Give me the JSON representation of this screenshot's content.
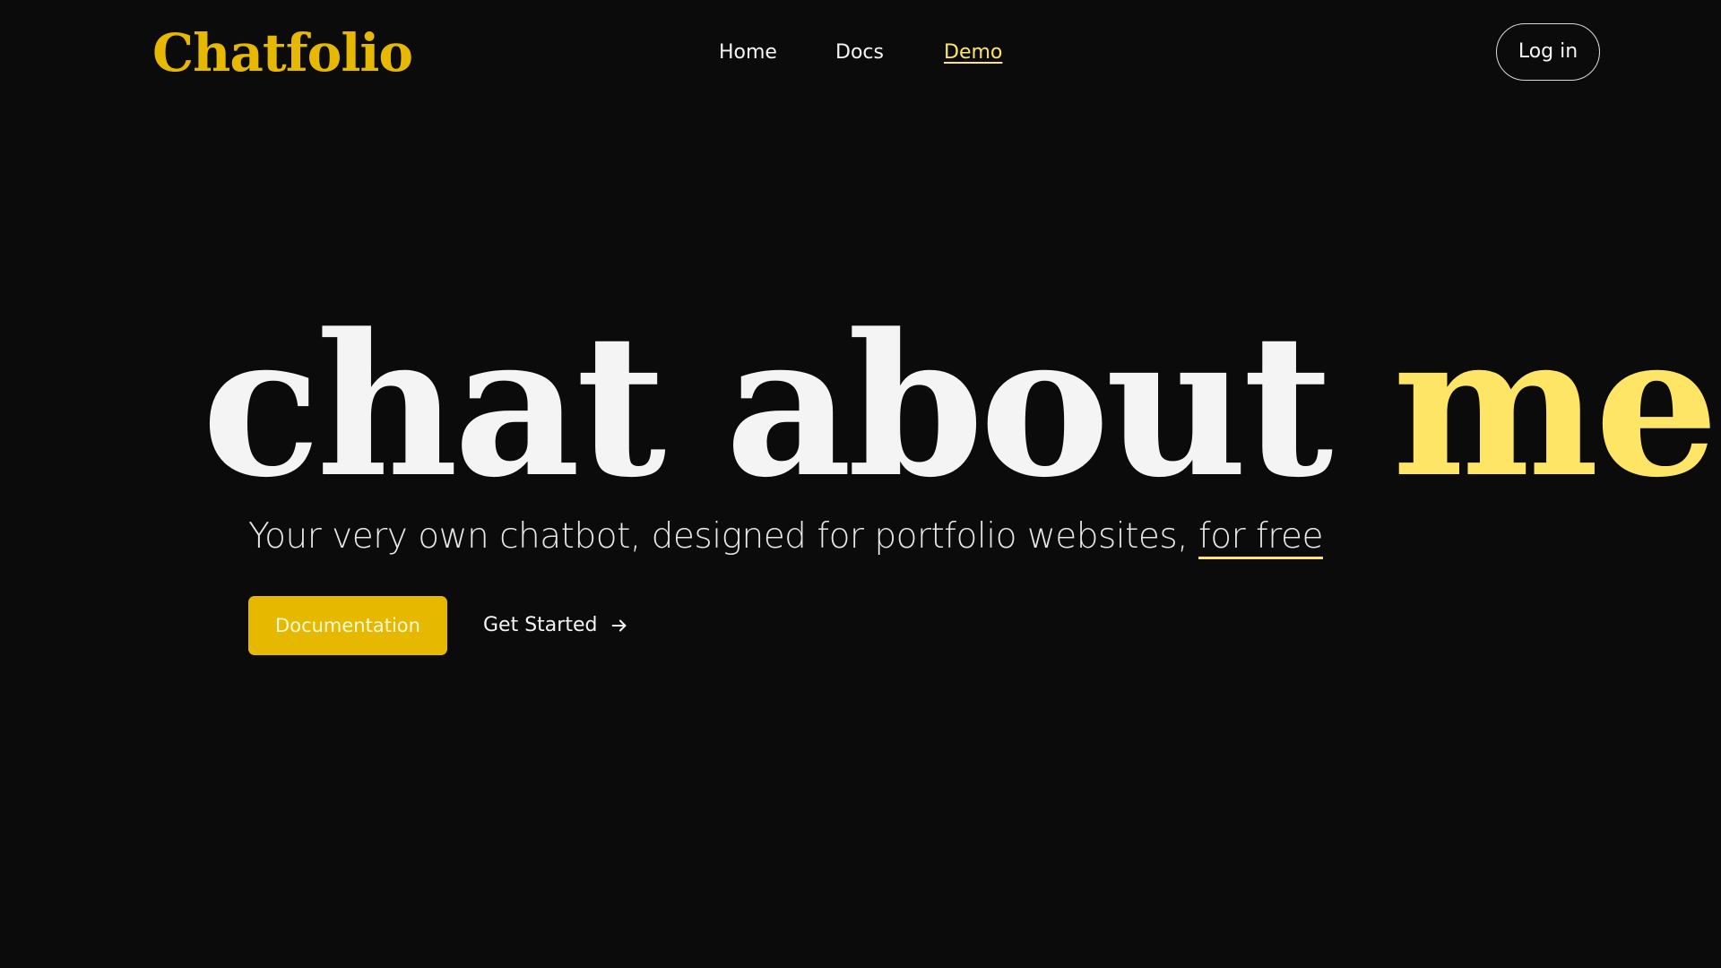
{
  "header": {
    "logo": "Chatfolio",
    "nav": [
      {
        "label": "Home",
        "active": false
      },
      {
        "label": "Docs",
        "active": false
      },
      {
        "label": "Demo",
        "active": true
      }
    ],
    "login_label": "Log in"
  },
  "hero": {
    "title_main": "chat about ",
    "title_accent": "me",
    "subtitle_main": "Your very own chatbot, designed for portfolio websites, ",
    "subtitle_highlight": "for free"
  },
  "actions": {
    "primary_label": "Documentation",
    "secondary_label": "Get Started",
    "secondary_icon": "arrow-right-icon"
  },
  "colors": {
    "background": "#0b0b0b",
    "brand_yellow": "#e6b800",
    "accent_yellow": "#ffe566",
    "text": "#f4f4f4"
  }
}
